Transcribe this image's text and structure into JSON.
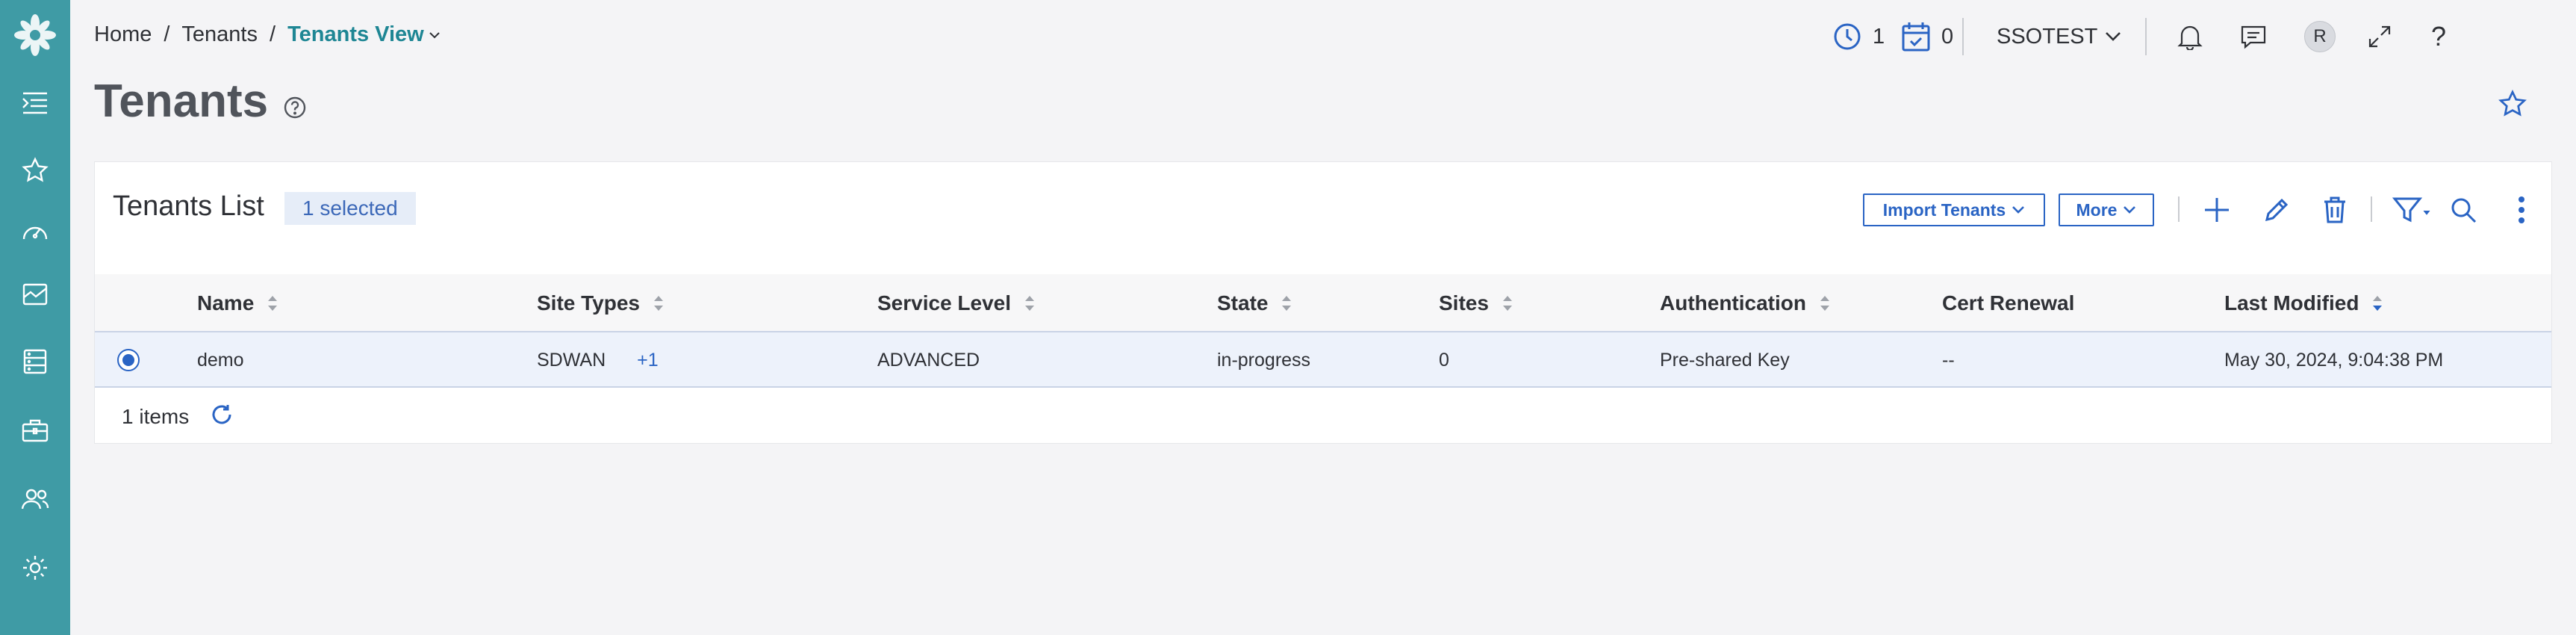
{
  "breadcrumb": {
    "home": "Home",
    "separator": "/",
    "tenants": "Tenants",
    "current": "Tenants View"
  },
  "page": {
    "title": "Tenants"
  },
  "header": {
    "clock_count": "1",
    "calendar_count": "0",
    "tenant_name": "SSOTEST",
    "avatar_initial": "R",
    "help_label": "?"
  },
  "card": {
    "title": "Tenants List",
    "selected_badge": "1 selected",
    "import_button": "Import Tenants",
    "more_button": "More"
  },
  "table": {
    "columns": [
      {
        "label": "Name",
        "sortable": true
      },
      {
        "label": "Site Types",
        "sortable": true
      },
      {
        "label": "Service Level",
        "sortable": true
      },
      {
        "label": "State",
        "sortable": true
      },
      {
        "label": "Sites",
        "sortable": true
      },
      {
        "label": "Authentication",
        "sortable": true
      },
      {
        "label": "Cert Renewal",
        "sortable": false
      },
      {
        "label": "Last Modified",
        "sortable": true,
        "sorted": "desc"
      }
    ],
    "rows": [
      {
        "selected": true,
        "name": "demo",
        "site_types": "SDWAN",
        "site_types_more": "+1",
        "service_level": "ADVANCED",
        "state": "in-progress",
        "sites": "0",
        "authentication": "Pre-shared Key",
        "cert_renewal": "--",
        "last_modified": "May 30, 2024, 9:04:38 PM"
      }
    ],
    "footer_count": "1 items"
  },
  "colors": {
    "sidebar": "#3f9ba5",
    "accent": "#2a64c4",
    "breadcrumb_current": "#1e8694",
    "row_selected": "#edf2fb"
  }
}
